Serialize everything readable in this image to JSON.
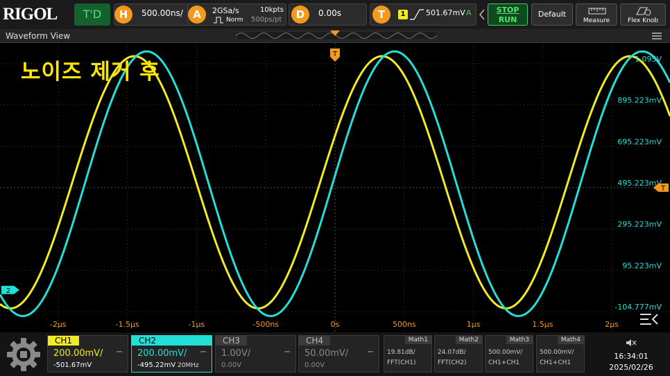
{
  "topbar": {
    "logo": "RIGOL",
    "trigger_status": "T'D",
    "horizontal": {
      "badge": "H",
      "timebase": "500.00ns/"
    },
    "acquire": {
      "badge": "A",
      "sample_rate": "2GSa/s",
      "mode": "Norm",
      "memory_depth": "10kpts",
      "time_per_point": "500ps/pt"
    },
    "delay": {
      "badge": "D",
      "value": "0.00s"
    },
    "trigger": {
      "badge": "T",
      "source": "1",
      "level": "501.67mV",
      "mode": "A"
    },
    "run_stop": {
      "line1": "STOP",
      "line2": "RUN"
    },
    "default_label": "Default",
    "measure_label": "Measure",
    "flexknob_label": "Flex Knob"
  },
  "waveform_view": {
    "title": "Waveform View",
    "annotation": "노이즈 제거 후",
    "trigger_marker": "T",
    "channel_marker": "2",
    "voltage_ticks": [
      {
        "label": "1.095V",
        "value": 1.095
      },
      {
        "label": "895.223mV",
        "value": 0.895
      },
      {
        "label": "695.223mV",
        "value": 0.695
      },
      {
        "label": "495.223mV",
        "value": 0.495
      },
      {
        "label": "295.223mV",
        "value": 0.295
      },
      {
        "label": "95.223mV",
        "value": 0.095
      },
      {
        "label": "-104.777mV",
        "value": -0.105
      }
    ],
    "time_ticks": [
      {
        "label": "-2μs",
        "value": -2.0
      },
      {
        "label": "-1.5μs",
        "value": -1.5
      },
      {
        "label": "-1μs",
        "value": -1.0
      },
      {
        "label": "-500ns",
        "value": -0.5
      },
      {
        "label": "0s",
        "value": 0.0
      },
      {
        "label": "500ns",
        "value": 0.5
      },
      {
        "label": "1μs",
        "value": 1.0
      },
      {
        "label": "1.5μs",
        "value": 1.5
      },
      {
        "label": "2μs",
        "value": 2.0
      }
    ]
  },
  "chart_data": {
    "type": "line",
    "xlabel": "",
    "ylabel": "",
    "xlim": [
      -2.42,
      2.42
    ],
    "ylim": [
      -0.205,
      1.195
    ],
    "grid": true,
    "series": [
      {
        "color": "#f2ea22",
        "amplitude": 0.61,
        "offset": 0.521,
        "period": 1.79,
        "phase_peak": -1.45
      },
      {
        "color": "#22e0d6",
        "amplitude": 0.64,
        "offset": 0.514,
        "period": 1.79,
        "phase_peak": -1.36
      }
    ]
  },
  "channels": [
    {
      "name": "CH1",
      "scale": "200.00mV/",
      "offset": "-501.67mV",
      "extra": "",
      "color": "#f2ea22",
      "active": true
    },
    {
      "name": "CH2",
      "scale": "200.00mV/",
      "offset": "-495.22mV",
      "extra": "20MHz",
      "color": "#22e0d6",
      "active": true
    },
    {
      "name": "CH3",
      "scale": "1.00V/",
      "offset": "0.00V",
      "extra": "",
      "color": "#8a8a8a",
      "active": false
    },
    {
      "name": "CH4",
      "scale": "50.00mV/",
      "offset": "0.00V",
      "extra": "",
      "color": "#8a8a8a",
      "active": false
    }
  ],
  "maths": [
    {
      "name": "Math1",
      "line1": "19.81dB/",
      "line2": "FFT(CH1)"
    },
    {
      "name": "Math2",
      "line1": "24.07dB/",
      "line2": "FFT(CH2)"
    },
    {
      "name": "Math3",
      "line1": "500.00mV/",
      "line2": "CH1+CH1"
    },
    {
      "name": "Math4",
      "line1": "500.00mV/",
      "line2": "CH1+CH1"
    }
  ],
  "status": {
    "time": "16:34:01",
    "date": "2025/02/26"
  }
}
